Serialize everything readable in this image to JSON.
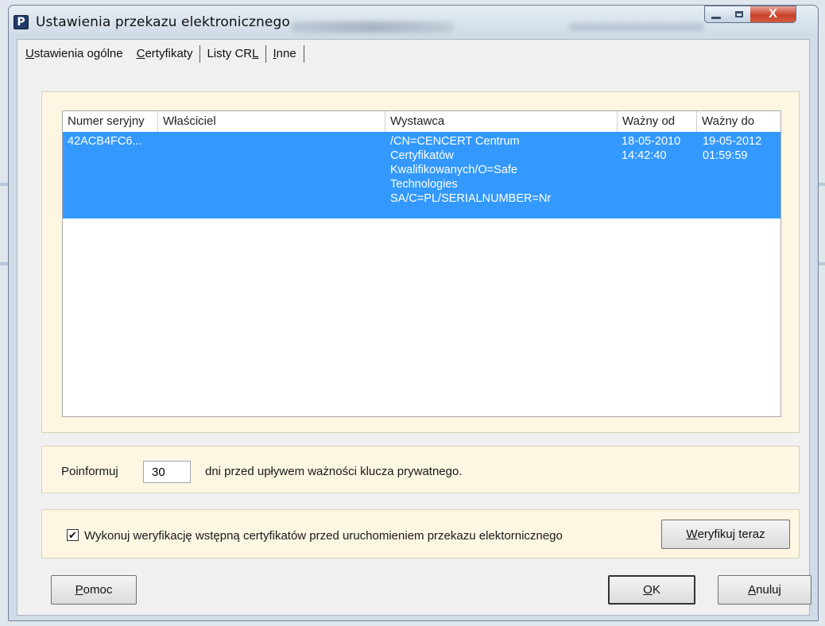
{
  "window": {
    "title": "Ustawienia przekazu elektronicznego",
    "icon_letter": "P",
    "close_glyph": "X"
  },
  "tabs": [
    {
      "label_pre": "",
      "mnemonic": "U",
      "label_post": "stawienia ogólne"
    },
    {
      "label_pre": "",
      "mnemonic": "C",
      "label_post": "ertyfikaty"
    },
    {
      "label_pre": "Listy CR",
      "mnemonic": "L",
      "label_post": ""
    },
    {
      "label_pre": "",
      "mnemonic": "I",
      "label_post": "nne"
    }
  ],
  "certificates": {
    "columns": [
      "Numer seryjny",
      "Właściciel",
      "Wystawca",
      "Ważny od",
      "Ważny do"
    ],
    "rows": [
      {
        "serial": "42ACB4FC6...",
        "owner": "",
        "issuer": "/CN=CENCERT Centrum\nCertyfikatów\nKwalifikowanych/O=Safe\nTechnologies\nSA/C=PL/SERIALNUMBER=Nr",
        "valid_from": "18-05-2010\n14:42:40",
        "valid_to": "19-05-2012\n01:59:59"
      }
    ]
  },
  "notify": {
    "label_before": "Poinformuj",
    "days_value": "30",
    "label_after": "dni przed upływem ważności klucza prywatnego."
  },
  "verify": {
    "checked": true,
    "check_glyph": "✔",
    "label": "Wykonuj weryfikację wstępną certyfikatów przed uruchomieniem przekazu elektornicznego",
    "button_mnemonic": "W",
    "button_rest": "eryfikuj teraz"
  },
  "buttons": {
    "help_mnemonic": "P",
    "help_rest": "omoc",
    "ok_mnemonic": "O",
    "ok_rest": "K",
    "cancel_mnemonic": "A",
    "cancel_rest": "nuluj"
  }
}
